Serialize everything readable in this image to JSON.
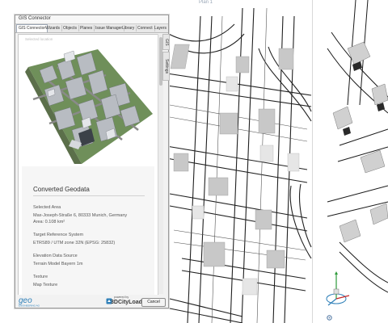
{
  "viewport": {
    "plan_label": "Plan 1"
  },
  "window": {
    "title": "GIS Connector",
    "tabs": [
      "GIS Connector",
      "Wizards",
      "Objects",
      "Planes",
      "Issue Manager",
      "Library",
      "Connect",
      "Layers"
    ],
    "side_tabs": [
      "GIS",
      "Settings"
    ],
    "preview_hint": "Selected location",
    "panel": {
      "heading": "Converted Geodata",
      "sections": [
        {
          "label": "Selected Area",
          "lines": [
            "Max-Joseph-Straße 6, 80333 Munich, Germany",
            "Area: 0.108 km²"
          ]
        },
        {
          "label": "Target Reference System",
          "lines": [
            "ETRS89 / UTM zone 32N (EPSG: 25832)"
          ]
        },
        {
          "label": "Elevation Data Source",
          "lines": [
            "Terrain Model Bayern 1m"
          ]
        },
        {
          "label": "Texture",
          "lines": [
            "Map Texture"
          ]
        }
      ]
    },
    "footer": {
      "geo_logo_text": "geo",
      "geo_logo_sub": "ENGINEERING AG",
      "powered_by": "powered by",
      "loader_text": "3DCityLoader",
      "cancel_label": "Cancel"
    }
  },
  "colors": {
    "accent": "#2d7fb8",
    "border": "#9a9a9a"
  },
  "icons": [
    "navigation-cube-icon",
    "gear-icon",
    "3dcityloader-badge-icon",
    "geo-engineering-logo"
  ]
}
